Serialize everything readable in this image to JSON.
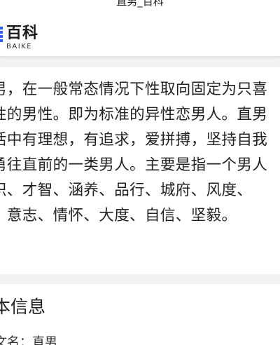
{
  "browser": {
    "tab_title": "直男_百科"
  },
  "header": {
    "logo_cn": "百科",
    "logo_en": "BAIKE",
    "brand_color": "#2e5bff",
    "logo_icon": "book-icon"
  },
  "article": {
    "lines": [
      "男，在一般常态情况下性取向固定为只喜",
      "性的男性。即为标准的异性恋男人。直男",
      "活中有理想，有追求，爱拼搏，坚持自我",
      "勇往直前的一类男人。主要是指一个男人",
      "识、才智、涵养、品行、城府、风度、",
      "、意志、情怀、大度、自信、坚毅。"
    ]
  },
  "section": {
    "title": "本信息",
    "row_label": "文名：直男"
  }
}
